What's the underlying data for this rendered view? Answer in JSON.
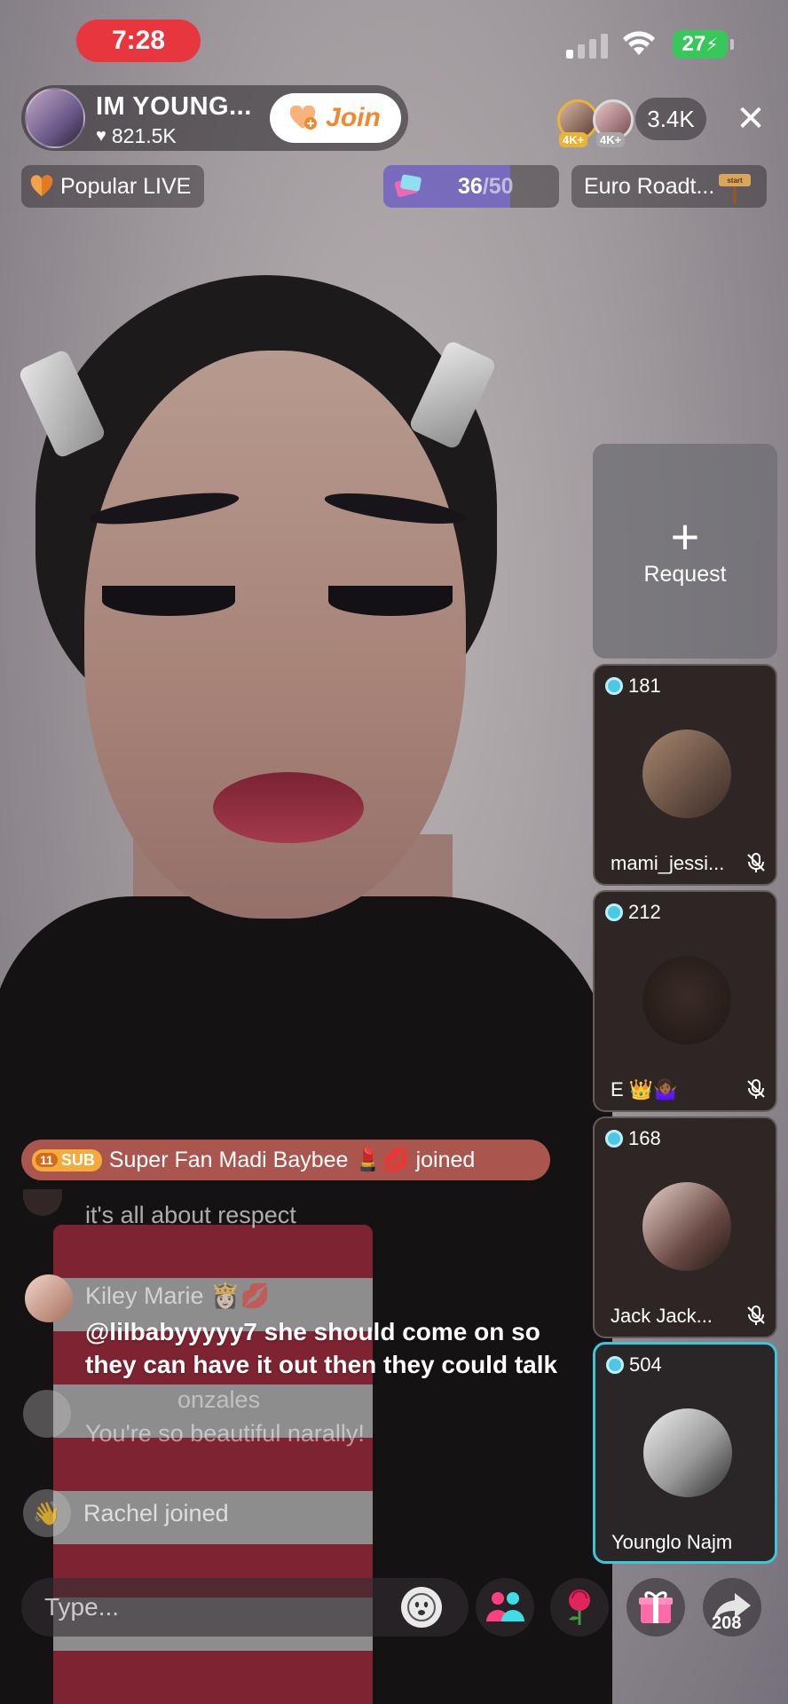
{
  "status_bar": {
    "time": "7:28",
    "battery": "27"
  },
  "host": {
    "name": "IM YOUNG...",
    "likes": "821.5K",
    "join_label": "Join"
  },
  "viewers": {
    "badge_a": "4K+",
    "badge_b": "4K+",
    "count": "3.4K"
  },
  "tags": {
    "popular": "Popular LIVE",
    "goal_current": "36",
    "goal_total": "/50",
    "goal_fraction": 0.72,
    "event": "Euro Roadt..."
  },
  "request": {
    "plus": "+",
    "label": "Request"
  },
  "guests": [
    {
      "score": "181",
      "name": "mami_jessi...",
      "muted": true
    },
    {
      "score": "212",
      "name": "E 👑🤷🏾‍♀️",
      "muted": true
    },
    {
      "score": "168",
      "name": "Jack Jack...",
      "muted": true
    },
    {
      "score": "504",
      "name": "Younglo Najm",
      "muted": false
    }
  ],
  "chat": {
    "banner_level": "11",
    "banner_badge": "SUB",
    "banner_text": "Super Fan Madi Baybee 💄💋 joined",
    "faded_line": "it's all about respect",
    "msg_user": "Kiley Marie 👸🏻💋",
    "msg_text": "@lilbabyyyyy7 she should come on so they can have it out then they could talk",
    "ghost_user": "onzales",
    "ghost_text": "You're so beautiful narally!",
    "joined_text": "Rachel joined",
    "input_placeholder": "Type..."
  },
  "bottom": {
    "share_count": "208"
  },
  "colors": {
    "time_pill": "#e8363f",
    "battery": "#37c75a",
    "join_text": "#f2882d",
    "active_guest_border": "#3ec6d6",
    "banner": "#dc6e64"
  }
}
